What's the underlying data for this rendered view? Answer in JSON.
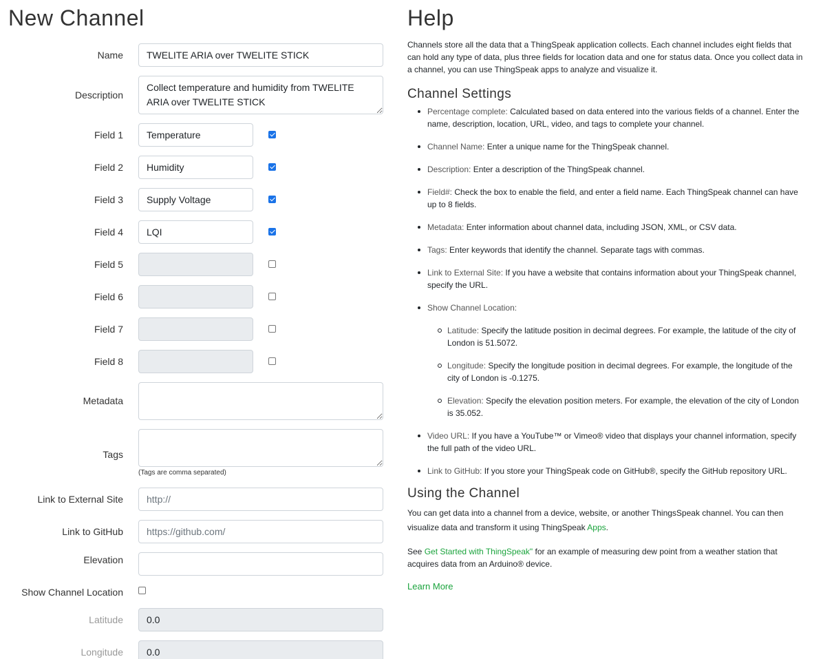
{
  "left": {
    "title": "New Channel",
    "name": {
      "label": "Name",
      "value": "TWELITE ARIA over TWELITE STICK"
    },
    "description": {
      "label": "Description",
      "value": "Collect temperature and humidity from TWELITE ARIA over TWELITE STICK"
    },
    "fields": [
      {
        "label": "Field 1",
        "value": "Temperature",
        "checked": true
      },
      {
        "label": "Field 2",
        "value": "Humidity",
        "checked": true
      },
      {
        "label": "Field 3",
        "value": "Supply Voltage",
        "checked": true
      },
      {
        "label": "Field 4",
        "value": "LQI",
        "checked": true
      },
      {
        "label": "Field 5",
        "value": "",
        "checked": false
      },
      {
        "label": "Field 6",
        "value": "",
        "checked": false
      },
      {
        "label": "Field 7",
        "value": "",
        "checked": false
      },
      {
        "label": "Field 8",
        "value": "",
        "checked": false
      }
    ],
    "metadata": {
      "label": "Metadata",
      "value": ""
    },
    "tags": {
      "label": "Tags",
      "value": "",
      "hint": "(Tags are comma separated)"
    },
    "external_site": {
      "label": "Link to External Site",
      "placeholder": "http://"
    },
    "github": {
      "label": "Link to GitHub",
      "placeholder": "https://github.com/"
    },
    "elevation": {
      "label": "Elevation",
      "value": ""
    },
    "show_location": {
      "label": "Show Channel Location",
      "checked": false
    },
    "latitude": {
      "label": "Latitude",
      "value": "0.0"
    },
    "longitude": {
      "label": "Longitude",
      "value": "0.0"
    }
  },
  "help": {
    "title": "Help",
    "intro": "Channels store all the data that a ThingSpeak application collects. Each channel includes eight fields that can hold any type of data, plus three fields for location data and one for status data. Once you collect data in a channel, you can use ThingSpeak apps to analyze and visualize it.",
    "settings_heading": "Channel Settings",
    "items": [
      {
        "term": "Percentage complete:",
        "text": " Calculated based on data entered into the various fields of a channel. Enter the name, description, location, URL, video, and tags to complete your channel."
      },
      {
        "term": "Channel Name:",
        "text": " Enter a unique name for the ThingSpeak channel."
      },
      {
        "term": "Description:",
        "text": " Enter a description of the ThingSpeak channel."
      },
      {
        "term": "Field#:",
        "text": " Check the box to enable the field, and enter a field name. Each ThingSpeak channel can have up to 8 fields."
      },
      {
        "term": "Metadata:",
        "text": " Enter information about channel data, including JSON, XML, or CSV data."
      },
      {
        "term": "Tags:",
        "text": " Enter keywords that identify the channel. Separate tags with commas."
      },
      {
        "term": "Link to External Site:",
        "text": " If you have a website that contains information about your ThingSpeak channel, specify the URL."
      },
      {
        "term": "Show Channel Location:",
        "text": ""
      }
    ],
    "location_items": [
      {
        "term": "Latitude:",
        "text": " Specify the latitude position in decimal degrees. For example, the latitude of the city of London is 51.5072."
      },
      {
        "term": "Longitude:",
        "text": " Specify the longitude position in decimal degrees. For example, the longitude of the city of London is -0.1275."
      },
      {
        "term": "Elevation:",
        "text": " Specify the elevation position meters. For example, the elevation of the city of London is 35.052."
      }
    ],
    "items2": [
      {
        "term": "Video URL:",
        "text": " If you have a YouTube™ or Vimeo® video that displays your channel information, specify the full path of the video URL."
      },
      {
        "term": "Link to GitHub:",
        "text": " If you store your ThingSpeak code on GitHub®, specify the GitHub repository URL."
      }
    ],
    "using_heading": "Using the Channel",
    "using_text": "You can get data into a channel from a device, website, or another ThingsSpeak channel. You can then visualize data and transform it using ThingSpeak ",
    "apps_link": "Apps",
    "using_end": ".",
    "see_prefix": "See ",
    "get_started_link": "Get Started with ThingSpeak\"",
    "see_text": " for an example of measuring dew point from a weather station that acquires data from an Arduino® device.",
    "learn_more": "Learn More"
  }
}
